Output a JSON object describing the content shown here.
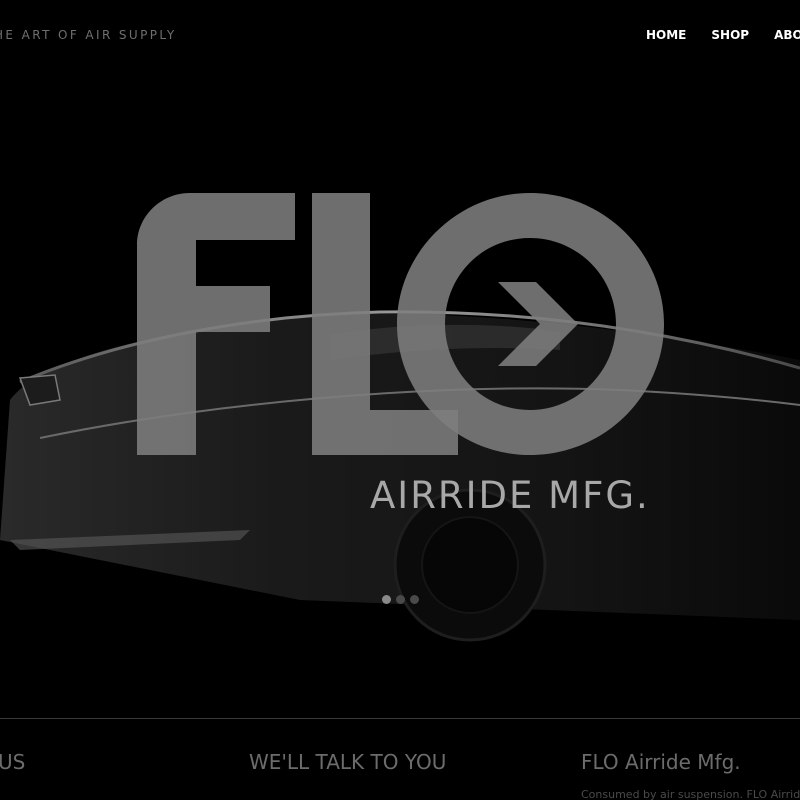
{
  "header": {
    "tagline": "HE ART OF AIR SUPPLY",
    "nav": [
      {
        "label": "HOME"
      },
      {
        "label": "SHOP"
      },
      {
        "label": "ABOUT"
      }
    ]
  },
  "hero": {
    "logo_text": "FLO",
    "logo_subtitle": "AIRRIDE MFG.",
    "slides_count": 3,
    "active_slide": 1
  },
  "footer": {
    "col1_title": "US",
    "col2_title": "WE'LL TALK TO YOU",
    "col3_title": "FLO Airride Mfg.",
    "col3_text": "Consumed by air suspension. FLO Airride"
  },
  "colors": {
    "background": "#000000",
    "logo": "#7d7d7d",
    "nav_text": "#ffffff",
    "muted_text": "#6c6c6c"
  }
}
